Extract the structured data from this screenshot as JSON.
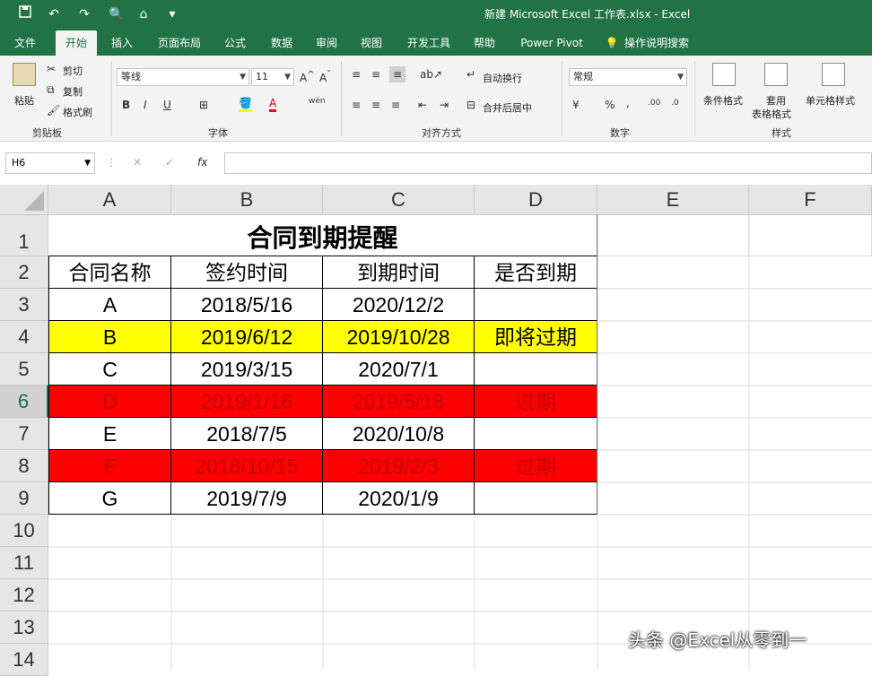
{
  "window": {
    "title": "新建 Microsoft Excel 工作表.xlsx  -  Excel"
  },
  "quick_access": {
    "save_icon": "save-icon",
    "undo_icon": "undo-icon",
    "redo_icon": "redo-icon",
    "print_preview_icon": "print-preview-icon",
    "customize_icon": "customize-icon"
  },
  "tabs": [
    "文件",
    "开始",
    "插入",
    "页面布局",
    "公式",
    "数据",
    "审阅",
    "视图",
    "开发工具",
    "帮助",
    "Power Pivot",
    "操作说明搜索"
  ],
  "active_tab": "开始",
  "ribbon": {
    "clipboard": {
      "paste": "粘贴",
      "cut": "剪切",
      "copy": "复制",
      "format_painter": "格式刷",
      "label": "剪贴板"
    },
    "font": {
      "name": "等线",
      "size": "11",
      "bold": "B",
      "italic": "I",
      "underline": "U",
      "label": "字体",
      "phonetic": "wén"
    },
    "alignment": {
      "wrap": "自动换行",
      "merge": "合并后居中",
      "label": "对齐方式"
    },
    "number": {
      "format": "常规",
      "percent": "%",
      "comma": ",",
      "label": "数字"
    },
    "styles": {
      "conditional": "条件格式",
      "table_format_1": "套用",
      "table_format_2": "表格格式",
      "cell_styles": "单元格样式",
      "label": "样式"
    }
  },
  "formula_bar": {
    "name_box": "H6",
    "value": ""
  },
  "columns": [
    "A",
    "B",
    "C",
    "D",
    "E",
    "F"
  ],
  "rows": [
    "1",
    "2",
    "3",
    "4",
    "5",
    "6",
    "7",
    "8",
    "9",
    "10",
    "11",
    "12",
    "13",
    "14"
  ],
  "sheet": {
    "title": "合同到期提醒",
    "headers": [
      "合同名称",
      "签约时间",
      "到期时间",
      "是否到期"
    ],
    "data": [
      {
        "name": "A",
        "sign": "2018/5/16",
        "due": "2020/12/2",
        "status": "",
        "fill": "none"
      },
      {
        "name": "B",
        "sign": "2019/6/12",
        "due": "2019/10/28",
        "status": "即将过期",
        "fill": "yellow"
      },
      {
        "name": "C",
        "sign": "2019/3/15",
        "due": "2020/7/1",
        "status": "",
        "fill": "none"
      },
      {
        "name": "D",
        "sign": "2019/1/16",
        "due": "2019/5/18",
        "status": "过期",
        "fill": "red"
      },
      {
        "name": "E",
        "sign": "2018/7/5",
        "due": "2020/10/8",
        "status": "",
        "fill": "none"
      },
      {
        "name": "F",
        "sign": "2018/10/15",
        "due": "2019/2/3",
        "status": "过期",
        "fill": "red"
      },
      {
        "name": "G",
        "sign": "2019/7/9",
        "due": "2020/1/9",
        "status": "",
        "fill": "none"
      }
    ]
  },
  "colors": {
    "brand": "#217346",
    "yellow_fill": "#ffff00",
    "red_fill": "#ff0000",
    "red_text": "#c00000"
  },
  "watermark": "头条 @Excel从零到一"
}
